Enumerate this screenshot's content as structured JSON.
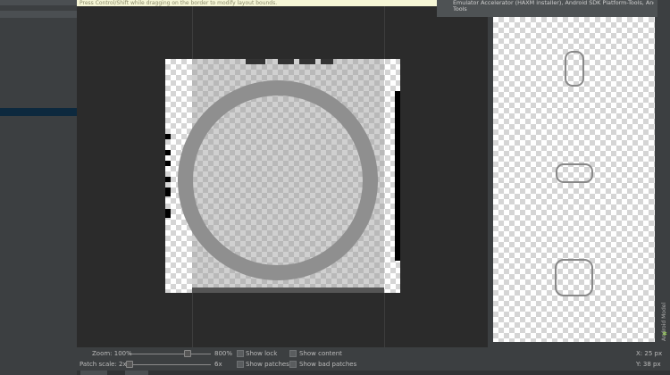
{
  "hint_bar": {
    "text": "Press Control/Shift while dragging on the border to modify layout bounds."
  },
  "tooltip": {
    "line1": "Emulator Accelerator (HAXM installer), Android SDK Platform-Tools, Android SDK",
    "line2": "Tools"
  },
  "status_bar": {
    "zoom_label": "Zoom: 100%",
    "zoom_max": "800%",
    "patch_scale_label": "Patch scale:",
    "patch_scale_min": "2x",
    "patch_scale_max": "6x",
    "show_lock": "Show lock",
    "show_content": "Show content",
    "show_patches": "Show patches",
    "show_bad_patches": "Show bad patches",
    "x_coord": "X: 25 px",
    "y_coord": "Y: 38 px"
  },
  "right_gutter": {
    "label": "Android Model"
  },
  "icons": {
    "android": "android-icon",
    "checkbox": "checkbox-icon",
    "slider_knob": "slider-knob-icon"
  },
  "colors": {
    "editor_bg": "#2b2b2b",
    "panel_bg": "#3c3f41",
    "selection": "#0d293e",
    "patch_marker": "#000000",
    "hint_bg": "#f6f6d6"
  }
}
